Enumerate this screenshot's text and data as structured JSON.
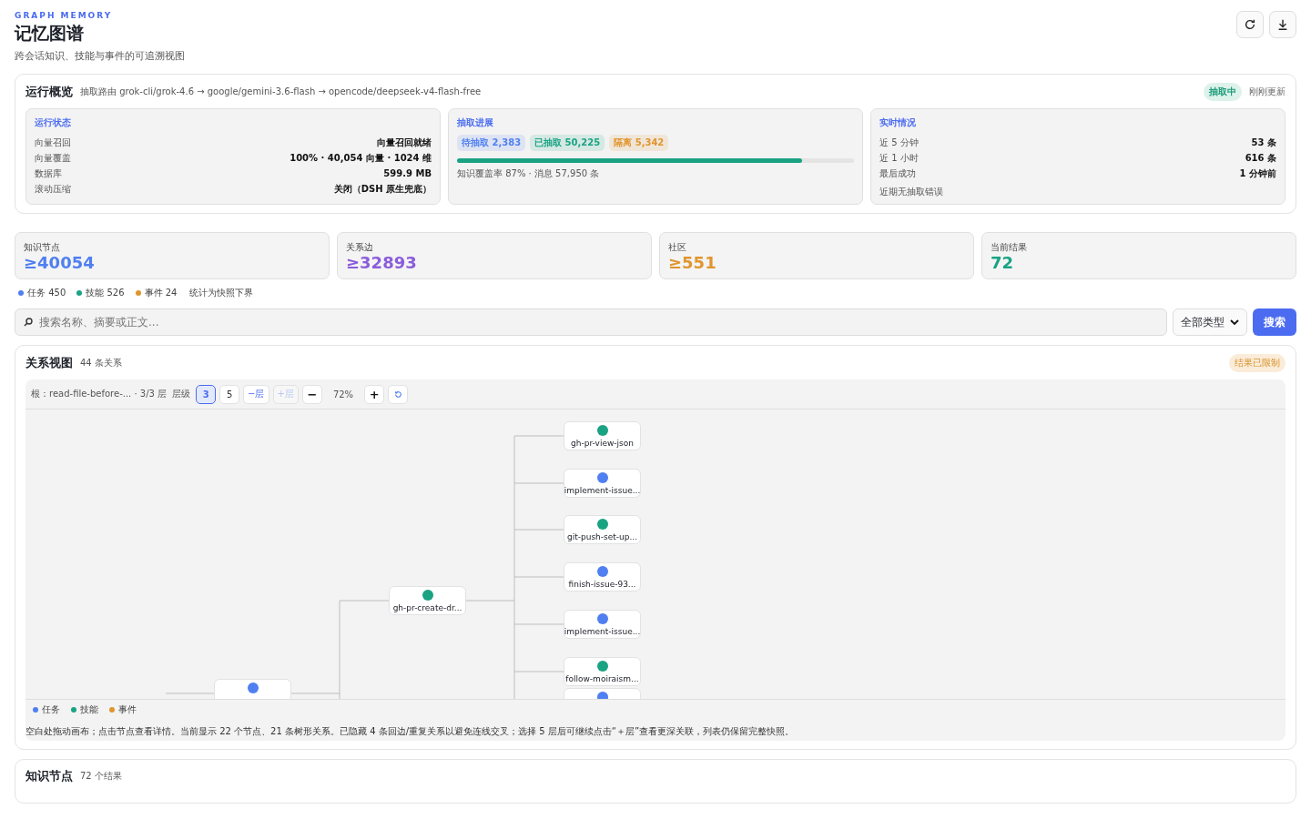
{
  "header": {
    "eyebrow": "GRAPH MEMORY",
    "title": "记忆图谱",
    "subtitle": "跨会话知识、技能与事件的可追溯视图"
  },
  "overview": {
    "title": "运行概览",
    "route": "抽取路由 grok-cli/grok-4.6 → google/gemini-3.6-flash → opencode/deepseek-v4-flash-free",
    "status_badge": "抽取中",
    "updated": "刚刚更新",
    "status": {
      "title": "运行状态",
      "rows": [
        {
          "label": "向量召回",
          "value": "向量召回就绪"
        },
        {
          "label": "向量覆盖",
          "value": "100% · 40,054 向量 · 1024 维"
        },
        {
          "label": "数据库",
          "value": "599.9 MB"
        },
        {
          "label": "滚动压缩",
          "value": "关闭（DSH 原生兜底）"
        }
      ]
    },
    "progress": {
      "title": "抽取进展",
      "chips": [
        {
          "label": "待抽取 2,383",
          "color": "#4f7ff0"
        },
        {
          "label": "已抽取 50,225",
          "color": "#1aa383"
        },
        {
          "label": "隔离 5,342",
          "color": "#e0952f"
        }
      ],
      "level": 0.87,
      "note": "知识覆盖率 87% · 消息 57,950 条"
    },
    "realtime": {
      "title": "实时情况",
      "rows": [
        {
          "label": "近 5 分钟",
          "value": "53 条"
        },
        {
          "label": "近 1 小时",
          "value": "616 条"
        },
        {
          "label": "最后成功",
          "value": "1 分钟前"
        }
      ],
      "note": "近期无抽取错误"
    }
  },
  "stats": [
    {
      "label": "知识节点",
      "value": "≥40054",
      "color": "#4f7ff0"
    },
    {
      "label": "关系边",
      "value": "≥32893",
      "color": "#8a5cdb"
    },
    {
      "label": "社区",
      "value": "≥551",
      "color": "#e0952f"
    },
    {
      "label": "当前结果",
      "value": "72",
      "color": "#1aa383"
    }
  ],
  "legend": [
    {
      "label": "任务 450",
      "color": "#4f7ff0"
    },
    {
      "label": "技能 526",
      "color": "#1aa383"
    },
    {
      "label": "事件 24",
      "color": "#e0952f"
    }
  ],
  "legend_note": "统计为快照下界",
  "search": {
    "placeholder": "搜索名称、摘要或正文...",
    "type_select": "全部类型",
    "button": "搜索"
  },
  "graph": {
    "title": "关系视图",
    "count": "44 条关系",
    "limit_badge": "结果已限制",
    "toolbar": {
      "root": "根：read-file-before-... · 3/3 层",
      "depth_label": "层级",
      "depths": [
        {
          "label": "3",
          "selected": true
        },
        {
          "label": "5",
          "selected": false
        }
      ],
      "less": "−层",
      "more": "+层",
      "more_disabled": true,
      "zoom_out": "−",
      "zoom": "72%",
      "zoom_in": "+"
    },
    "nodes": [
      {
        "label": "gh-pr-view-json",
        "color": "#1aa383"
      },
      {
        "label": "implement-issue...",
        "color": "#4f7ff0"
      },
      {
        "label": "git-push-set-up...",
        "color": "#1aa383"
      },
      {
        "label": "finish-issue-93...",
        "color": "#4f7ff0"
      },
      {
        "label": "implement-issue...",
        "color": "#4f7ff0"
      },
      {
        "label": "follow-moiraism...",
        "color": "#1aa383"
      },
      {
        "color": "#4f7ff0"
      },
      {
        "label": "gh-pr-create-dr...",
        "color": "#1aa383"
      },
      {
        "color": "#4f7ff0"
      }
    ],
    "legend": [
      {
        "label": "任务",
        "color": "#4f7ff0"
      },
      {
        "label": "技能",
        "color": "#1aa383"
      },
      {
        "label": "事件",
        "color": "#e0952f"
      }
    ],
    "help": "空白处拖动画布；点击节点查看详情。当前显示 22 个节点、21 条树形关系。已隐藏 4 条回边/重复关系以避免连线交叉；选择 5 层后可继续点击“＋层”查看更深关联，列表仍保留完整快照。"
  },
  "list": {
    "title": "知识节点",
    "count": "72 个结果"
  }
}
